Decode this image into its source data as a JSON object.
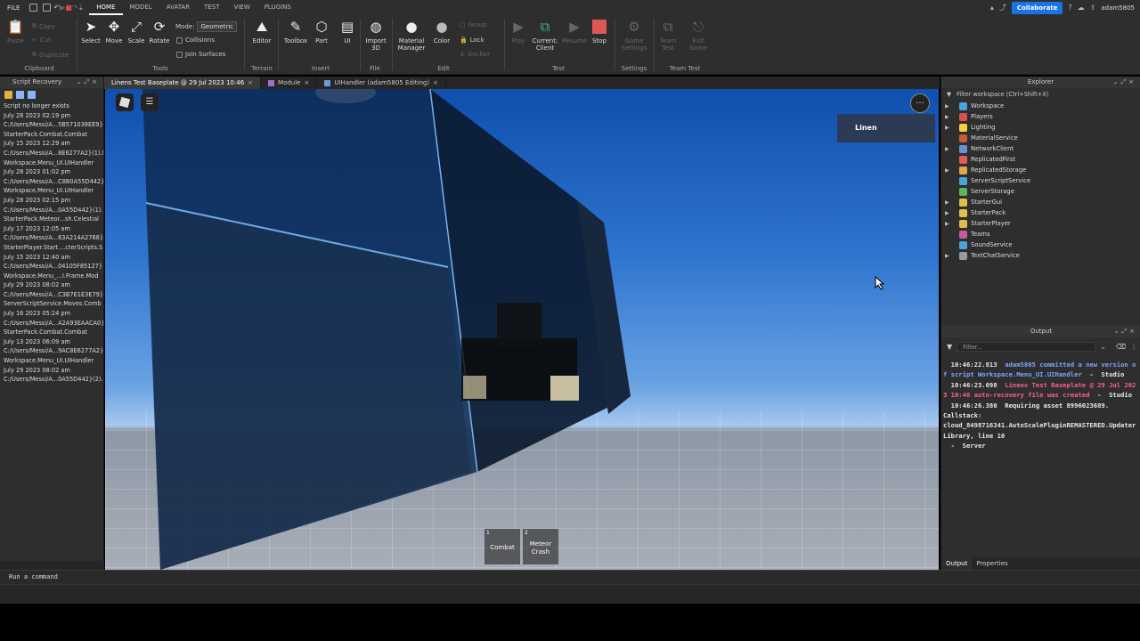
{
  "menubar": {
    "file": "FILE",
    "tabs": [
      "HOME",
      "MODEL",
      "AVATAR",
      "TEST",
      "VIEW",
      "PLUGINS"
    ],
    "collaborate": "Collaborate",
    "username": "adam5805"
  },
  "ribbon": {
    "clipboard": {
      "paste": "Paste",
      "copy": "Copy",
      "cut": "Cut",
      "duplicate": "Duplicate",
      "label": "Clipboard"
    },
    "tools": {
      "select": "Select",
      "move": "Move",
      "scale": "Scale",
      "rotate": "Rotate",
      "mode_label": "Mode:",
      "mode_value": "Geometric",
      "collisions": "Collisions",
      "join_surfaces": "Join Surfaces",
      "label": "Tools"
    },
    "terrain": {
      "editor": "Editor",
      "label": "Terrain"
    },
    "insert": {
      "toolbox": "Toolbox",
      "part": "Part",
      "ui": "UI",
      "label": "Insert"
    },
    "file": {
      "import3d_line1": "Import",
      "import3d_line2": "3D",
      "label": "File"
    },
    "edit": {
      "material_line1": "Material",
      "material_line2": "Manager",
      "color": "Color",
      "group": "Group",
      "lock": "Lock",
      "anchor": "Anchor",
      "label": "Edit"
    },
    "test": {
      "play": "Play",
      "current_line1": "Current:",
      "current_line2": "Client",
      "resume": "Resume",
      "stop": "Stop",
      "label": "Test"
    },
    "settings": {
      "game_line1": "Game",
      "game_line2": "Settings",
      "label": "Settings"
    },
    "team_test": {
      "team_line1": "Team",
      "team_line2": "Test",
      "exit_line1": "Exit",
      "exit_line2": "Game",
      "label": "Team Test"
    }
  },
  "script_recovery": {
    "title": "Script Recovery",
    "items": [
      "Script no longer exists",
      "July 28 2023 02:19 pm",
      "C:/Users/Messi/A...5B571038EE9}",
      "StarterPack.Combat.Combat",
      "July 15 2023 12:29 am",
      "C:/Users/Messi/A...8E6277A2}(1).l",
      "Workspace.Menu_UI.UIHandler",
      "July 28 2023 01:02 pm",
      "C:/Users/Messi/A...C8B0A55D442}",
      "Workspace.Menu_UI.UIHandler",
      "July 28 2023 02:15 pm",
      "C:/Users/Messi/A...0A55D442}(1)...",
      "StarterPack.Meteor...sh.Celestial",
      "July 17 2023 12:05 am",
      "C:/Users/Messi/A...63A214A2768}",
      "StarterPlayer.Start....cterScripts.S",
      "July 15 2023 12:40 am",
      "C:/Users/Messi/A...04105F85127}",
      "Workspace.Menu_...I.Frame.Mod",
      "July 29 2023 08:02 am",
      "C:/Users/Messi/A...C3B7E1E3E79}",
      "ServerScriptService.Moves.Comb",
      "July 16 2023 05:24 pm",
      "C:/Users/Messi/A...A2A93EAACA0}",
      "StarterPack.Combat.Combat",
      "July 13 2023 06:09 am",
      "C:/Users/Messi/A...9AC8E6277A2}",
      "Workspace.Menu_UI.UIHandler",
      "July 29 2023 08:02 am",
      "C:/Users/Messi/A...0A55D442}(2)..."
    ]
  },
  "doc_tabs": [
    {
      "label": "Linens Test Baseplate @ 29 Jul 2023 10:46",
      "close": "×"
    },
    {
      "label": "Module",
      "close": "×"
    },
    {
      "label": "UIHandler (adam5805 Editing)",
      "close": "×"
    }
  ],
  "viewport": {
    "name_card": "Linen",
    "more": "···",
    "hotbar": [
      {
        "num": "1",
        "label": "Combat"
      },
      {
        "num": "2",
        "label": "Meteor Crash"
      }
    ]
  },
  "explorer": {
    "title": "Explorer",
    "filter": "Filter workspace (Ctrl+Shift+X)",
    "items": [
      {
        "label": "Workspace",
        "arrow": "▶",
        "color": "#4aa3df"
      },
      {
        "label": "Players",
        "arrow": "▶",
        "color": "#d94f4f"
      },
      {
        "label": "Lighting",
        "arrow": "▶",
        "color": "#f2d13a"
      },
      {
        "label": "MaterialService",
        "arrow": "",
        "color": "#c75a3a"
      },
      {
        "label": "NetworkClient",
        "arrow": "▶",
        "color": "#6b8fd6"
      },
      {
        "label": "ReplicatedFirst",
        "arrow": "",
        "color": "#e05c5c"
      },
      {
        "label": "ReplicatedStorage",
        "arrow": "▶",
        "color": "#e0a84a"
      },
      {
        "label": "ServerScriptService",
        "arrow": "",
        "color": "#4aa3df"
      },
      {
        "label": "ServerStorage",
        "arrow": "",
        "color": "#5bb85b"
      },
      {
        "label": "StarterGui",
        "arrow": "▶",
        "color": "#e0c04a"
      },
      {
        "label": "StarterPack",
        "arrow": "▶",
        "color": "#e0c04a"
      },
      {
        "label": "StarterPlayer",
        "arrow": "▶",
        "color": "#e0c04a"
      },
      {
        "label": "Teams",
        "arrow": "",
        "color": "#c75a9a"
      },
      {
        "label": "SoundService",
        "arrow": "",
        "color": "#4aa3df"
      },
      {
        "label": "TextChatService",
        "arrow": "▶",
        "color": "#9a9a9a"
      }
    ]
  },
  "output": {
    "title": "Output",
    "filter_placeholder": "Filter...",
    "lines": [
      {
        "parts": [
          {
            "t": "  10:46:22.813  ",
            "c": "c-white"
          },
          {
            "t": "adam5805 committed a new version of script Workspace.Menu_UI.UIHandler",
            "c": "c-blue"
          },
          {
            "t": "  -  Studio",
            "c": "c-white"
          }
        ]
      },
      {
        "parts": [
          {
            "t": "  10:46:23.098  ",
            "c": "c-white"
          },
          {
            "t": "Linens Test Baseplate @ 29 Jul 2023 10:46 auto-recovery file was created",
            "c": "c-pink"
          },
          {
            "t": "  -  Studio",
            "c": "c-white"
          }
        ]
      },
      {
        "parts": [
          {
            "t": "  10:46:26.380  Requiring asset 8996023689.",
            "c": "c-white"
          }
        ]
      },
      {
        "parts": [
          {
            "t": "Callstack:",
            "c": "c-white"
          }
        ]
      },
      {
        "parts": [
          {
            "t": "cloud_8498716341.AutoScalePluginREMASTERED.UpdaterLibrary, line 10",
            "c": "c-white"
          }
        ]
      },
      {
        "parts": [
          {
            "t": "  -  Server",
            "c": "c-white"
          }
        ]
      }
    ]
  },
  "right_tabs": [
    "Output",
    "Properties"
  ],
  "command_bar": "Run a command"
}
